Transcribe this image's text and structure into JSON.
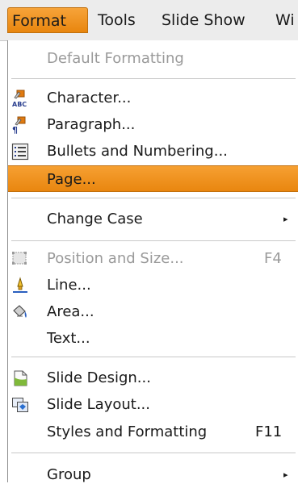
{
  "menubar": {
    "format": "Format",
    "tools": "Tools",
    "slide_show": "Slide Show",
    "window_partial": "Wi"
  },
  "menu": {
    "default_formatting": "Default Formatting",
    "character": "Character...",
    "paragraph": "Paragraph...",
    "bullets": "Bullets and Numbering...",
    "page": "Page...",
    "change_case": "Change Case",
    "position_size": "Position and Size...",
    "position_size_shortcut": "F4",
    "line": "Line...",
    "area": "Area...",
    "text": "Text...",
    "slide_design": "Slide Design...",
    "slide_layout": "Slide Layout...",
    "styles": "Styles and Formatting",
    "styles_shortcut": "F11",
    "group": "Group",
    "submenu_arrow": "▸"
  },
  "colors": {
    "highlight": "#e9860f",
    "disabled_text": "#9a9a9a"
  },
  "icons": {
    "character": "character-abc-icon",
    "paragraph": "paragraph-icon",
    "bullets": "bullets-numbering-icon",
    "position_size": "position-size-icon",
    "line": "line-icon",
    "area": "area-fill-icon",
    "slide_design": "slide-design-icon",
    "slide_layout": "slide-layout-icon"
  }
}
